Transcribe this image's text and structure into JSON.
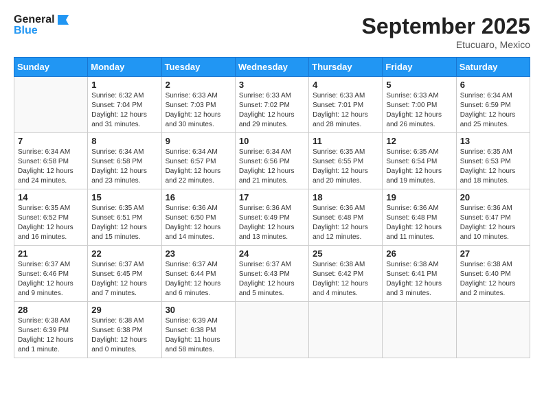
{
  "header": {
    "logo_line1": "General",
    "logo_line2": "Blue",
    "month": "September 2025",
    "location": "Etucuaro, Mexico"
  },
  "days_of_week": [
    "Sunday",
    "Monday",
    "Tuesday",
    "Wednesday",
    "Thursday",
    "Friday",
    "Saturday"
  ],
  "weeks": [
    [
      {
        "num": "",
        "info": ""
      },
      {
        "num": "1",
        "info": "Sunrise: 6:32 AM\nSunset: 7:04 PM\nDaylight: 12 hours\nand 31 minutes."
      },
      {
        "num": "2",
        "info": "Sunrise: 6:33 AM\nSunset: 7:03 PM\nDaylight: 12 hours\nand 30 minutes."
      },
      {
        "num": "3",
        "info": "Sunrise: 6:33 AM\nSunset: 7:02 PM\nDaylight: 12 hours\nand 29 minutes."
      },
      {
        "num": "4",
        "info": "Sunrise: 6:33 AM\nSunset: 7:01 PM\nDaylight: 12 hours\nand 28 minutes."
      },
      {
        "num": "5",
        "info": "Sunrise: 6:33 AM\nSunset: 7:00 PM\nDaylight: 12 hours\nand 26 minutes."
      },
      {
        "num": "6",
        "info": "Sunrise: 6:34 AM\nSunset: 6:59 PM\nDaylight: 12 hours\nand 25 minutes."
      }
    ],
    [
      {
        "num": "7",
        "info": "Sunrise: 6:34 AM\nSunset: 6:58 PM\nDaylight: 12 hours\nand 24 minutes."
      },
      {
        "num": "8",
        "info": "Sunrise: 6:34 AM\nSunset: 6:58 PM\nDaylight: 12 hours\nand 23 minutes."
      },
      {
        "num": "9",
        "info": "Sunrise: 6:34 AM\nSunset: 6:57 PM\nDaylight: 12 hours\nand 22 minutes."
      },
      {
        "num": "10",
        "info": "Sunrise: 6:34 AM\nSunset: 6:56 PM\nDaylight: 12 hours\nand 21 minutes."
      },
      {
        "num": "11",
        "info": "Sunrise: 6:35 AM\nSunset: 6:55 PM\nDaylight: 12 hours\nand 20 minutes."
      },
      {
        "num": "12",
        "info": "Sunrise: 6:35 AM\nSunset: 6:54 PM\nDaylight: 12 hours\nand 19 minutes."
      },
      {
        "num": "13",
        "info": "Sunrise: 6:35 AM\nSunset: 6:53 PM\nDaylight: 12 hours\nand 18 minutes."
      }
    ],
    [
      {
        "num": "14",
        "info": "Sunrise: 6:35 AM\nSunset: 6:52 PM\nDaylight: 12 hours\nand 16 minutes."
      },
      {
        "num": "15",
        "info": "Sunrise: 6:35 AM\nSunset: 6:51 PM\nDaylight: 12 hours\nand 15 minutes."
      },
      {
        "num": "16",
        "info": "Sunrise: 6:36 AM\nSunset: 6:50 PM\nDaylight: 12 hours\nand 14 minutes."
      },
      {
        "num": "17",
        "info": "Sunrise: 6:36 AM\nSunset: 6:49 PM\nDaylight: 12 hours\nand 13 minutes."
      },
      {
        "num": "18",
        "info": "Sunrise: 6:36 AM\nSunset: 6:48 PM\nDaylight: 12 hours\nand 12 minutes."
      },
      {
        "num": "19",
        "info": "Sunrise: 6:36 AM\nSunset: 6:48 PM\nDaylight: 12 hours\nand 11 minutes."
      },
      {
        "num": "20",
        "info": "Sunrise: 6:36 AM\nSunset: 6:47 PM\nDaylight: 12 hours\nand 10 minutes."
      }
    ],
    [
      {
        "num": "21",
        "info": "Sunrise: 6:37 AM\nSunset: 6:46 PM\nDaylight: 12 hours\nand 9 minutes."
      },
      {
        "num": "22",
        "info": "Sunrise: 6:37 AM\nSunset: 6:45 PM\nDaylight: 12 hours\nand 7 minutes."
      },
      {
        "num": "23",
        "info": "Sunrise: 6:37 AM\nSunset: 6:44 PM\nDaylight: 12 hours\nand 6 minutes."
      },
      {
        "num": "24",
        "info": "Sunrise: 6:37 AM\nSunset: 6:43 PM\nDaylight: 12 hours\nand 5 minutes."
      },
      {
        "num": "25",
        "info": "Sunrise: 6:38 AM\nSunset: 6:42 PM\nDaylight: 12 hours\nand 4 minutes."
      },
      {
        "num": "26",
        "info": "Sunrise: 6:38 AM\nSunset: 6:41 PM\nDaylight: 12 hours\nand 3 minutes."
      },
      {
        "num": "27",
        "info": "Sunrise: 6:38 AM\nSunset: 6:40 PM\nDaylight: 12 hours\nand 2 minutes."
      }
    ],
    [
      {
        "num": "28",
        "info": "Sunrise: 6:38 AM\nSunset: 6:39 PM\nDaylight: 12 hours\nand 1 minute."
      },
      {
        "num": "29",
        "info": "Sunrise: 6:38 AM\nSunset: 6:38 PM\nDaylight: 12 hours\nand 0 minutes."
      },
      {
        "num": "30",
        "info": "Sunrise: 6:39 AM\nSunset: 6:38 PM\nDaylight: 11 hours\nand 58 minutes."
      },
      {
        "num": "",
        "info": ""
      },
      {
        "num": "",
        "info": ""
      },
      {
        "num": "",
        "info": ""
      },
      {
        "num": "",
        "info": ""
      }
    ]
  ]
}
